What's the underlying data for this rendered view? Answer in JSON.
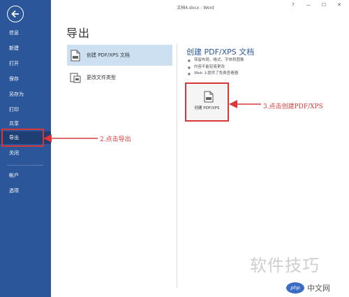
{
  "window": {
    "title": "文档4.docx - Word",
    "controls": [
      "?",
      "—",
      "☐",
      "✕"
    ]
  },
  "sidebar": {
    "items": [
      {
        "label": "信息"
      },
      {
        "label": "新建"
      },
      {
        "label": "打开"
      },
      {
        "label": "保存"
      },
      {
        "label": "另存为"
      },
      {
        "label": "打印"
      },
      {
        "label": "共享"
      },
      {
        "label": "导出"
      },
      {
        "label": "关闭"
      },
      {
        "label": "帐户"
      },
      {
        "label": "选项"
      }
    ],
    "active_item": "导出"
  },
  "export": {
    "heading": "导出",
    "options": [
      {
        "label": "创建 PDF/XPS 文档",
        "selected": true
      },
      {
        "label": "更改文件类型",
        "selected": false
      }
    ]
  },
  "detail": {
    "title": "创建 PDF/XPS 文档",
    "bullets": [
      "保留布局、格式、字体和图像",
      "内容不能轻易更改",
      "Web 上提供了免费查看器"
    ],
    "button_label": "创建 PDF/XPS"
  },
  "annotations": {
    "step2": "2.点击导出",
    "step3": "3.点击创建PDF/XPS"
  },
  "colors": {
    "sidebar": "#2b579a",
    "annotation": "#d9383a",
    "selected": "#cde0f2"
  },
  "watermark": {
    "text": "软件技巧",
    "logo_badge": "php",
    "logo_text": "中文网"
  }
}
